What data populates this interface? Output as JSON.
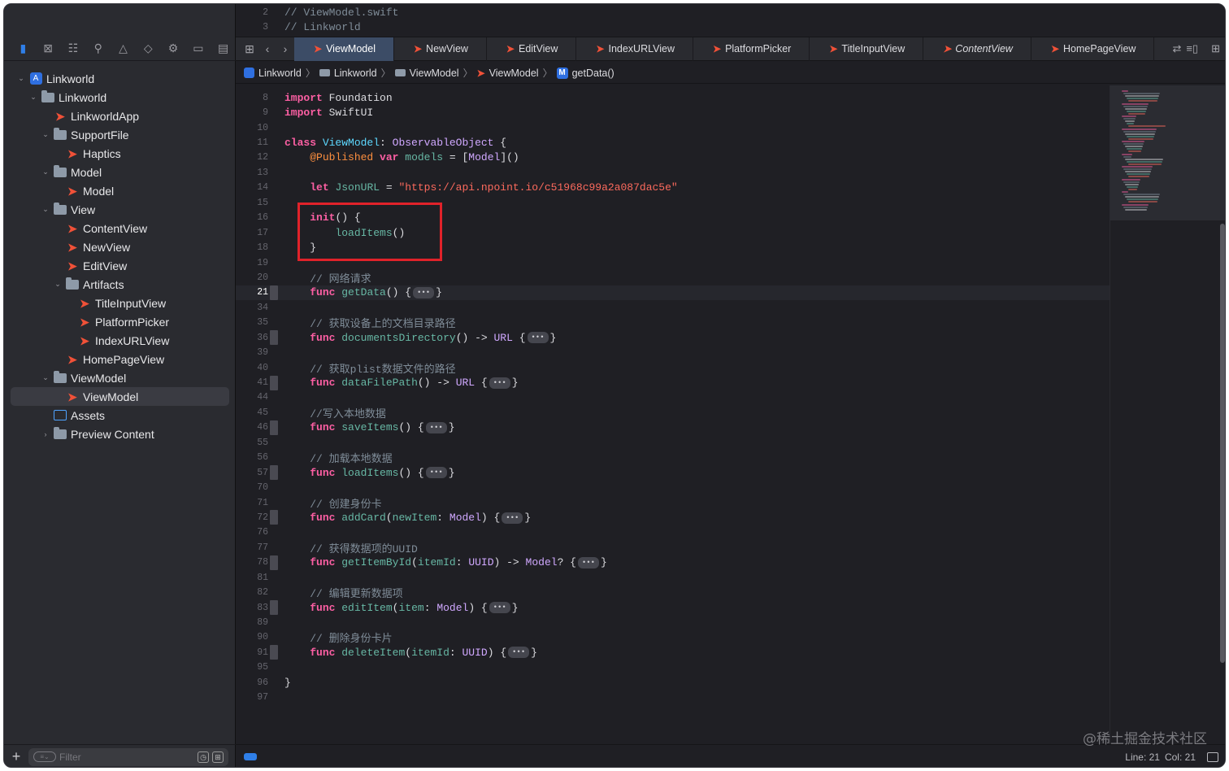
{
  "sidebar": {
    "nav_icons": [
      "folder-icon",
      "source-control-icon",
      "hierarchy-icon",
      "search-icon",
      "warning-icon",
      "test-icon",
      "debug-icon",
      "breakpoint-icon",
      "report-icon"
    ],
    "tree": [
      {
        "label": "Linkworld",
        "icon": "app",
        "indent": 0,
        "disclosure": "open"
      },
      {
        "label": "Linkworld",
        "icon": "folder",
        "indent": 1,
        "disclosure": "open"
      },
      {
        "label": "LinkworldApp",
        "icon": "swift",
        "indent": 2,
        "disclosure": ""
      },
      {
        "label": "SupportFile",
        "icon": "folder",
        "indent": 2,
        "disclosure": "open"
      },
      {
        "label": "Haptics",
        "icon": "swift",
        "indent": 3,
        "disclosure": ""
      },
      {
        "label": "Model",
        "icon": "folder",
        "indent": 2,
        "disclosure": "open"
      },
      {
        "label": "Model",
        "icon": "swift",
        "indent": 3,
        "disclosure": ""
      },
      {
        "label": "View",
        "icon": "folder",
        "indent": 2,
        "disclosure": "open"
      },
      {
        "label": "ContentView",
        "icon": "swift",
        "indent": 3,
        "disclosure": ""
      },
      {
        "label": "NewView",
        "icon": "swift",
        "indent": 3,
        "disclosure": ""
      },
      {
        "label": "EditView",
        "icon": "swift",
        "indent": 3,
        "disclosure": ""
      },
      {
        "label": "Artifacts",
        "icon": "folder",
        "indent": 3,
        "disclosure": "open"
      },
      {
        "label": "TitleInputView",
        "icon": "swift",
        "indent": 4,
        "disclosure": ""
      },
      {
        "label": "PlatformPicker",
        "icon": "swift",
        "indent": 4,
        "disclosure": ""
      },
      {
        "label": "IndexURLView",
        "icon": "swift",
        "indent": 4,
        "disclosure": ""
      },
      {
        "label": "HomePageView",
        "icon": "swift",
        "indent": 3,
        "disclosure": ""
      },
      {
        "label": "ViewModel",
        "icon": "folder",
        "indent": 2,
        "disclosure": "open"
      },
      {
        "label": "ViewModel",
        "icon": "swift",
        "indent": 3,
        "disclosure": "",
        "selected": true
      },
      {
        "label": "Assets",
        "icon": "assets",
        "indent": 2,
        "disclosure": ""
      },
      {
        "label": "Preview Content",
        "icon": "folder",
        "indent": 2,
        "disclosure": "closed"
      }
    ],
    "filter_placeholder": "Filter",
    "add_label": "+"
  },
  "editor": {
    "top_lines": [
      {
        "num": "2",
        "text": "//  ViewModel.swift"
      },
      {
        "num": "3",
        "text": "//  Linkworld"
      }
    ],
    "tabs": [
      {
        "label": "ViewModel",
        "active": true
      },
      {
        "label": "NewView"
      },
      {
        "label": "EditView"
      },
      {
        "label": "IndexURLView"
      },
      {
        "label": "PlatformPicker"
      },
      {
        "label": "TitleInputView"
      },
      {
        "label": "ContentView",
        "italic": true
      },
      {
        "label": "HomePageView"
      }
    ],
    "jump_bar": [
      "Linkworld",
      "Linkworld",
      "ViewModel",
      "ViewModel",
      "getData()"
    ],
    "code_lines": [
      {
        "num": "8",
        "html": "<span class=\"kw\">import</span> Foundation"
      },
      {
        "num": "9",
        "html": "<span class=\"kw\">import</span> SwiftUI"
      },
      {
        "num": "10",
        "html": ""
      },
      {
        "num": "11",
        "html": "<span class=\"kw\">class</span> <span class=\"ty\">ViewModel</span>: <span class=\"tyd\">ObservableObject</span> {"
      },
      {
        "num": "12",
        "html": "    <span class=\"attr\">@Published</span> <span class=\"kw\">var</span> <span class=\"prop\">models</span> = [<span class=\"tyd\">Model</span>]()"
      },
      {
        "num": "13",
        "html": ""
      },
      {
        "num": "14",
        "html": "    <span class=\"kw\">let</span> <span class=\"prop\">JsonURL</span> = <span class=\"str\">\"https://api.npoint.io/c51968c99a2a087dac5e\"</span>"
      },
      {
        "num": "15",
        "html": ""
      },
      {
        "num": "16",
        "html": "    <span class=\"kw\">init</span>() {"
      },
      {
        "num": "17",
        "html": "        <span class=\"fn\">loadItems</span>()"
      },
      {
        "num": "18",
        "html": "    }"
      },
      {
        "num": "19",
        "html": ""
      },
      {
        "num": "20",
        "html": "    <span class=\"cm\">// 网络请求</span>"
      },
      {
        "num": "21",
        "html": "    <span class=\"kw\">func</span> <span class=\"fn\">getData</span>() {<span class=\"fold-pill\">•••</span>}",
        "fold": true,
        "current": true
      },
      {
        "num": "34",
        "html": ""
      },
      {
        "num": "35",
        "html": "    <span class=\"cm\">// 获取设备上的文档目录路径</span>"
      },
      {
        "num": "36",
        "html": "    <span class=\"kw\">func</span> <span class=\"fn\">documentsDirectory</span>() -> <span class=\"tyd\">URL</span> {<span class=\"fold-pill\">•••</span>}",
        "fold": true
      },
      {
        "num": "39",
        "html": ""
      },
      {
        "num": "40",
        "html": "    <span class=\"cm\">// 获取plist数据文件的路径</span>"
      },
      {
        "num": "41",
        "html": "    <span class=\"kw\">func</span> <span class=\"fn\">dataFilePath</span>() -> <span class=\"tyd\">URL</span> {<span class=\"fold-pill\">•••</span>}",
        "fold": true
      },
      {
        "num": "44",
        "html": ""
      },
      {
        "num": "45",
        "html": "    <span class=\"cm\">//写入本地数据</span>"
      },
      {
        "num": "46",
        "html": "    <span class=\"kw\">func</span> <span class=\"fn\">saveItems</span>() {<span class=\"fold-pill\">•••</span>}",
        "fold": true
      },
      {
        "num": "55",
        "html": ""
      },
      {
        "num": "56",
        "html": "    <span class=\"cm\">// 加载本地数据</span>"
      },
      {
        "num": "57",
        "html": "    <span class=\"kw\">func</span> <span class=\"fn\">loadItems</span>() {<span class=\"fold-pill\">•••</span>}",
        "fold": true
      },
      {
        "num": "70",
        "html": ""
      },
      {
        "num": "71",
        "html": "    <span class=\"cm\">// 创建身份卡</span>"
      },
      {
        "num": "72",
        "html": "    <span class=\"kw\">func</span> <span class=\"fn\">addCard</span>(<span class=\"fn\">newItem</span>: <span class=\"tyd\">Model</span>) {<span class=\"fold-pill\">•••</span>}",
        "fold": true
      },
      {
        "num": "76",
        "html": ""
      },
      {
        "num": "77",
        "html": "    <span class=\"cm\">// 获得数据项的UUID</span>"
      },
      {
        "num": "78",
        "html": "    <span class=\"kw\">func</span> <span class=\"fn\">getItemById</span>(<span class=\"fn\">itemId</span>: <span class=\"tyd\">UUID</span>) -> <span class=\"tyd\">Model</span>? {<span class=\"fold-pill\">•••</span>}",
        "fold": true
      },
      {
        "num": "81",
        "html": ""
      },
      {
        "num": "82",
        "html": "    <span class=\"cm\">// 编辑更新数据项</span>"
      },
      {
        "num": "83",
        "html": "    <span class=\"kw\">func</span> <span class=\"fn\">editItem</span>(<span class=\"fn\">item</span>: <span class=\"tyd\">Model</span>) {<span class=\"fold-pill\">•••</span>}",
        "fold": true
      },
      {
        "num": "89",
        "html": ""
      },
      {
        "num": "90",
        "html": "    <span class=\"cm\">// 删除身份卡片</span>"
      },
      {
        "num": "91",
        "html": "    <span class=\"kw\">func</span> <span class=\"fn\">deleteItem</span>(<span class=\"fn\">itemId</span>: <span class=\"tyd\">UUID</span>) {<span class=\"fold-pill\">•••</span>}",
        "fold": true
      },
      {
        "num": "95",
        "html": ""
      },
      {
        "num": "96",
        "html": "}"
      },
      {
        "num": "97",
        "html": ""
      }
    ],
    "status": {
      "line_label": "Line: 21",
      "col_label": "Col: 21"
    }
  },
  "watermark": "@稀土掘金技术社区",
  "colors": {
    "accent": "#2f7fe8",
    "swift": "#f05138",
    "highlight_box": "#e0222a"
  }
}
